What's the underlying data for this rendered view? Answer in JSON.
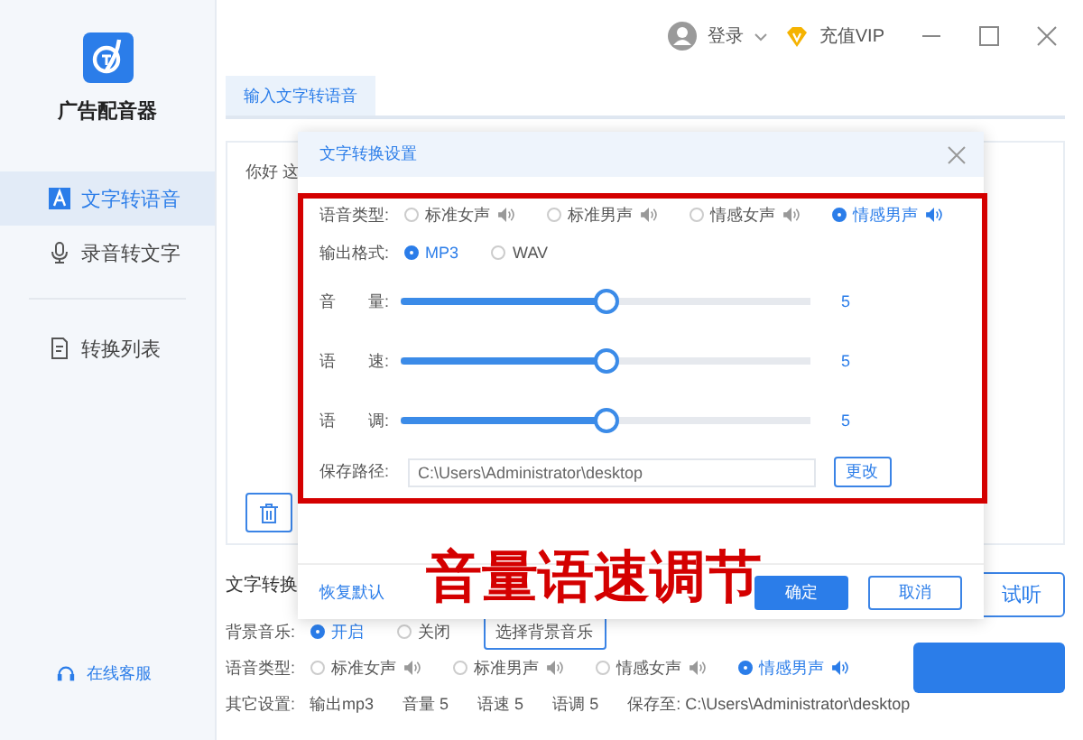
{
  "app": {
    "name": "广告配音器"
  },
  "sidebar": {
    "items": [
      {
        "label": "文字转语音",
        "selected": true
      },
      {
        "label": "录音转文字",
        "selected": false
      },
      {
        "label": "转换列表",
        "selected": false
      }
    ],
    "support": "在线客服"
  },
  "titlebar": {
    "login": "登录",
    "vip": "充值VIP"
  },
  "tabs": [
    {
      "label": "输入文字转语音",
      "selected": true
    }
  ],
  "editor": {
    "text": "你好 这"
  },
  "bottom": {
    "section_title": "文字转换",
    "listen_button": "试听",
    "bg_music": {
      "label": "背景音乐:",
      "options": [
        {
          "label": "开启",
          "selected": true
        },
        {
          "label": "关闭",
          "selected": false
        }
      ],
      "button": "选择背景音乐"
    },
    "voice": {
      "label": "语音类型:",
      "options": [
        {
          "label": "标准女声",
          "selected": false
        },
        {
          "label": "标准男声",
          "selected": false
        },
        {
          "label": "情感女声",
          "selected": false
        },
        {
          "label": "情感男声",
          "selected": true
        }
      ]
    },
    "other": {
      "label": "其它设置:",
      "items": [
        "输出mp3",
        "音量 5",
        "语速 5",
        "语调 5",
        "保存至: C:\\Users\\Administrator\\desktop"
      ]
    }
  },
  "dialog": {
    "title": "文字转换设置",
    "voice": {
      "label": "语音类型:",
      "options": [
        {
          "label": "标准女声",
          "selected": false
        },
        {
          "label": "标准男声",
          "selected": false
        },
        {
          "label": "情感女声",
          "selected": false
        },
        {
          "label": "情感男声",
          "selected": true
        }
      ]
    },
    "format": {
      "label": "输出格式:",
      "options": [
        {
          "label": "MP3",
          "selected": true
        },
        {
          "label": "WAV",
          "selected": false
        }
      ]
    },
    "sliders": [
      {
        "label": "音　　量:",
        "level": 0.5,
        "reading": "5"
      },
      {
        "label": "语　　速:",
        "level": 0.5,
        "reading": "5"
      },
      {
        "label": "语　　调:",
        "level": 0.5,
        "reading": "5"
      }
    ],
    "save_path": {
      "label": "保存路径:",
      "value": "C:\\Users\\Administrator\\desktop",
      "button": "更改"
    },
    "reset": "恢复默认",
    "ok": "确定",
    "cancel": "取消"
  },
  "annotation": {
    "caption": "音量语速调节"
  }
}
